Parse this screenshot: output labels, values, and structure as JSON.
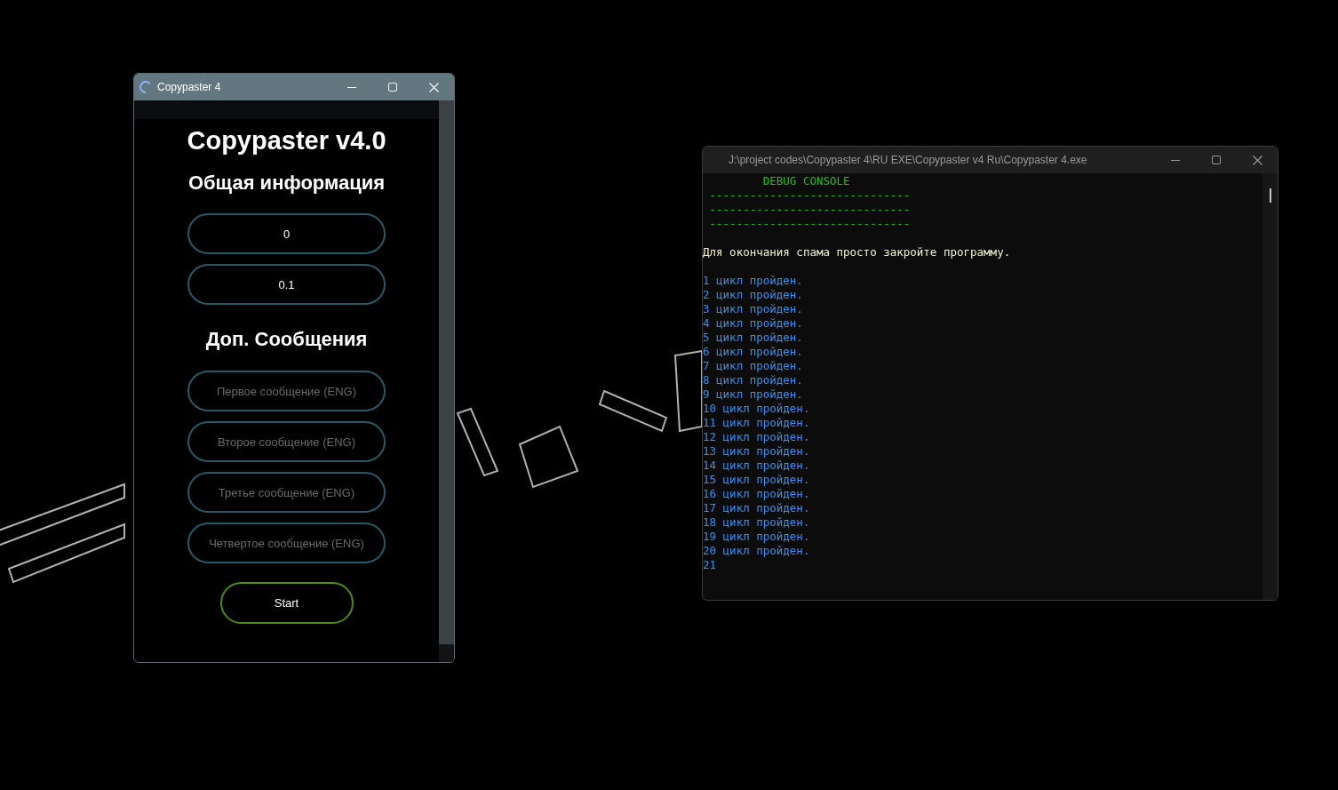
{
  "app_window": {
    "title": "Copypaster 4",
    "heading": "Copypaster v4.0",
    "section_1": "Общая информация",
    "value_fields": [
      {
        "value": "0"
      },
      {
        "value": "0.1"
      }
    ],
    "section_2": "Доп. Сообщения",
    "message_fields": [
      {
        "placeholder": "Первое сообщение (ENG)"
      },
      {
        "placeholder": "Второе сообщение (ENG)"
      },
      {
        "placeholder": "Третье сообщение (ENG)"
      },
      {
        "placeholder": "Четвертое сообщение (ENG)"
      }
    ],
    "start_button": "Start"
  },
  "console_window": {
    "title": "J:\\project codes\\Copypaster 4\\RU EXE\\Copypaster v4 Ru\\Copypaster 4.exe",
    "lines": [
      {
        "kind": "header",
        "text": "         DEBUG CONSOLE"
      },
      {
        "kind": "rule",
        "text": " ------------------------------"
      },
      {
        "kind": "rule",
        "text": " ------------------------------"
      },
      {
        "kind": "rule",
        "text": " ------------------------------"
      },
      {
        "kind": "blank"
      },
      {
        "kind": "info",
        "text": "Для окончания спама просто закройте программу."
      },
      {
        "kind": "blank"
      },
      {
        "kind": "progress",
        "text": "1 цикл пройден."
      },
      {
        "kind": "progress",
        "text": "2 цикл пройден."
      },
      {
        "kind": "progress",
        "text": "3 цикл пройден."
      },
      {
        "kind": "progress",
        "text": "4 цикл пройден."
      },
      {
        "kind": "progress",
        "text": "5 цикл пройден."
      },
      {
        "kind": "progress",
        "text": "6 цикл пройден."
      },
      {
        "kind": "progress",
        "text": "7 цикл пройден."
      },
      {
        "kind": "progress",
        "text": "8 цикл пройден."
      },
      {
        "kind": "progress",
        "text": "9 цикл пройден."
      },
      {
        "kind": "progress",
        "text": "10 цикл пройден."
      },
      {
        "kind": "progress",
        "text": "11 цикл пройден."
      },
      {
        "kind": "progress",
        "text": "12 цикл пройден."
      },
      {
        "kind": "progress",
        "text": "13 цикл пройден."
      },
      {
        "kind": "progress",
        "text": "14 цикл пройден."
      },
      {
        "kind": "progress",
        "text": "15 цикл пройден."
      },
      {
        "kind": "progress",
        "text": "16 цикл пройден."
      },
      {
        "kind": "progress",
        "text": "17 цикл пройден."
      },
      {
        "kind": "progress",
        "text": "18 цикл пройден."
      },
      {
        "kind": "progress",
        "text": "19 цикл пройден."
      },
      {
        "kind": "progress",
        "text": "20 цикл пройден."
      },
      {
        "kind": "progress",
        "text": "21"
      }
    ]
  }
}
